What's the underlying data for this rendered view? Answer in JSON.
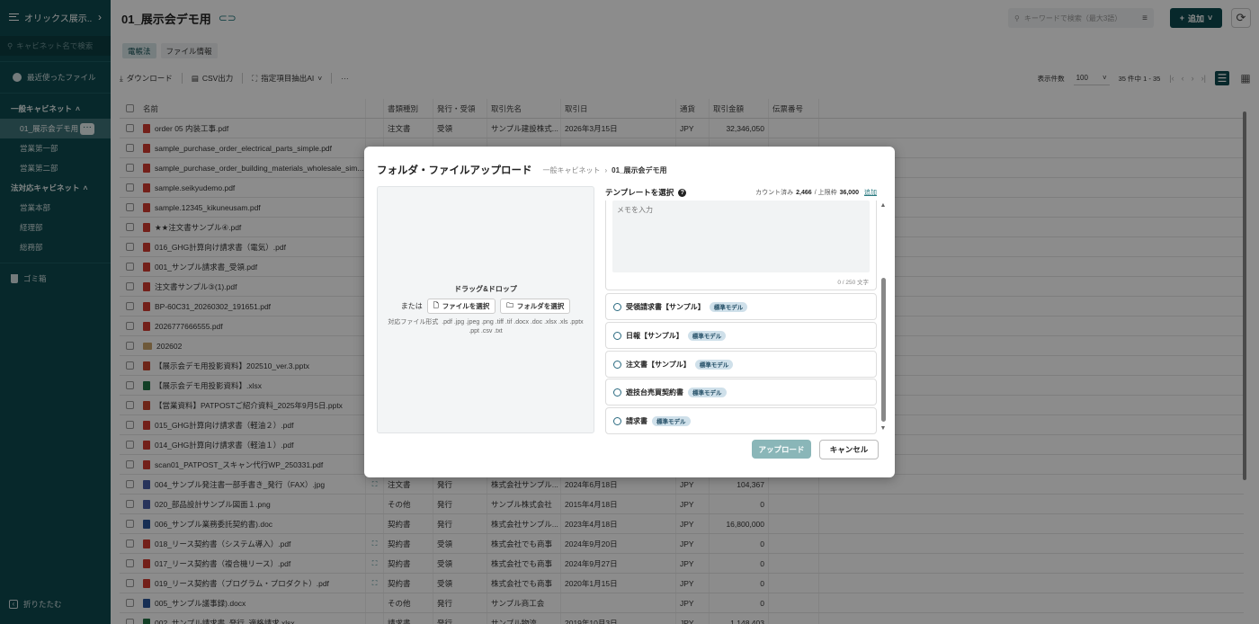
{
  "sidebar": {
    "org_name": "オリックス展示...",
    "search_placeholder": "キャビネット名で検索",
    "recent_label": "最近使ったファイル",
    "groups": [
      {
        "label": "一般キャビネット",
        "items": [
          "01_展示会デモ用",
          "営業第一部",
          "営業第二部"
        ]
      },
      {
        "label": "法対応キャビネット",
        "items": [
          "営業本部",
          "経理部",
          "総務部"
        ]
      }
    ],
    "trash_label": "ゴミ箱",
    "collapse_label": "折りたたむ"
  },
  "header": {
    "title": "01_展示会デモ用",
    "search_placeholder": "キーワードで検索（最大3語）",
    "add_label": "追加"
  },
  "tabs": [
    "電帳法",
    "ファイル情報"
  ],
  "toolbar": {
    "download": "ダウンロード",
    "csv": "CSV出力",
    "ai_extract": "指定項目抽出AI",
    "more": "···",
    "per_page_label": "表示件数",
    "per_page_value": "100",
    "count_text": "35 件中 1 - 35"
  },
  "table": {
    "columns": [
      "名前",
      "書類種別",
      "発行・受領",
      "取引先名",
      "取引日",
      "通貨",
      "取引金額",
      "伝票番号"
    ],
    "rows": [
      {
        "icon": "pdf",
        "name": "order 05 内装工事.pdf",
        "ai": false,
        "type": "注文書",
        "issue": "受領",
        "partner": "サンプル建設株式...",
        "date": "2026年3月15日",
        "cur": "JPY",
        "amount": "32,346,050"
      },
      {
        "icon": "pdf",
        "name": "sample_purchase_order_electrical_parts_simple.pdf",
        "ai": false,
        "type": "",
        "issue": "",
        "partner": "",
        "date": "",
        "cur": "",
        "amount": ""
      },
      {
        "icon": "pdf",
        "name": "sample_purchase_order_building_materials_wholesale_sim...",
        "ai": false,
        "type": "",
        "issue": "",
        "partner": "",
        "date": "",
        "cur": "",
        "amount": ""
      },
      {
        "icon": "pdf",
        "name": "sample.seikyudemo.pdf",
        "ai": false,
        "type": "",
        "issue": "",
        "partner": "",
        "date": "",
        "cur": "",
        "amount": ""
      },
      {
        "icon": "pdf",
        "name": "sample.12345_kikuneusam.pdf",
        "ai": false,
        "type": "",
        "issue": "",
        "partner": "",
        "date": "",
        "cur": "",
        "amount": ""
      },
      {
        "icon": "pdf",
        "name": "★★注文書サンプル④.pdf",
        "ai": true,
        "type": "",
        "issue": "",
        "partner": "",
        "date": "",
        "cur": "",
        "amount": ""
      },
      {
        "icon": "pdf",
        "name": "016_GHG計算向け請求書（電気）.pdf",
        "ai": true,
        "type": "",
        "issue": "",
        "partner": "",
        "date": "",
        "cur": "",
        "amount": ""
      },
      {
        "icon": "pdf",
        "name": "001_サンプル請求書_受領.pdf",
        "ai": true,
        "type": "",
        "issue": "",
        "partner": "",
        "date": "",
        "cur": "",
        "amount": ""
      },
      {
        "icon": "pdf",
        "name": "注文書サンプル③(1).pdf",
        "ai": true,
        "type": "",
        "issue": "",
        "partner": "",
        "date": "",
        "cur": "",
        "amount": ""
      },
      {
        "icon": "pdf",
        "name": "BP-60C31_20260302_191651.pdf",
        "ai": true,
        "type": "",
        "issue": "",
        "partner": "",
        "date": "",
        "cur": "",
        "amount": ""
      },
      {
        "icon": "pdf",
        "name": "2026777666555.pdf",
        "ai": true,
        "type": "",
        "issue": "",
        "partner": "",
        "date": "",
        "cur": "",
        "amount": ""
      },
      {
        "icon": "folder",
        "name": "202602",
        "ai": false,
        "type": "",
        "issue": "",
        "partner": "",
        "date": "",
        "cur": "",
        "amount": ""
      },
      {
        "icon": "pptx",
        "name": "【展示会デモ用投影資料】202510_ver.3.pptx",
        "ai": false,
        "type": "",
        "issue": "",
        "partner": "",
        "date": "",
        "cur": "",
        "amount": ""
      },
      {
        "icon": "xlsx",
        "name": "【展示会デモ用投影資料】.xlsx",
        "ai": false,
        "type": "",
        "issue": "",
        "partner": "",
        "date": "",
        "cur": "",
        "amount": ""
      },
      {
        "icon": "pptx",
        "name": "【営業資料】PATPOSTご紹介資料_2025年9月5日.pptx",
        "ai": false,
        "type": "",
        "issue": "",
        "partner": "",
        "date": "",
        "cur": "",
        "amount": ""
      },
      {
        "icon": "pdf",
        "name": "015_GHG計算向け請求書（軽油２）.pdf",
        "ai": true,
        "type": "",
        "issue": "",
        "partner": "",
        "date": "",
        "cur": "",
        "amount": ""
      },
      {
        "icon": "pdf",
        "name": "014_GHG計算向け請求書（軽油１）.pdf",
        "ai": true,
        "type": "",
        "issue": "",
        "partner": "",
        "date": "",
        "cur": "",
        "amount": ""
      },
      {
        "icon": "pdf",
        "name": "scan01_PATPOST_スキャン代行WP_250331.pdf",
        "ai": true,
        "type": "",
        "issue": "",
        "partner": "",
        "date": "",
        "cur": "",
        "amount": ""
      },
      {
        "icon": "jpg",
        "name": "004_サンプル発注書一部手書き_発行（FAX）.jpg",
        "ai": true,
        "type": "注文書",
        "issue": "発行",
        "partner": "株式会社サンプル...",
        "date": "2024年6月18日",
        "cur": "JPY",
        "amount": "104,367"
      },
      {
        "icon": "jpg",
        "name": "020_部品設計サンプル図面１.png",
        "ai": false,
        "type": "その他",
        "issue": "発行",
        "partner": "サンプル株式会社",
        "date": "2015年4月18日",
        "cur": "JPY",
        "amount": "0"
      },
      {
        "icon": "doc",
        "name": "006_サンプル業務委託契約書).doc",
        "ai": false,
        "type": "契約書",
        "issue": "発行",
        "partner": "株式会社サンプル...",
        "date": "2023年4月18日",
        "cur": "JPY",
        "amount": "16,800,000"
      },
      {
        "icon": "pdf",
        "name": "018_リース契約書（システム導入）.pdf",
        "ai": true,
        "type": "契約書",
        "issue": "受領",
        "partner": "株式会社でも商事",
        "date": "2024年9月20日",
        "cur": "JPY",
        "amount": "0"
      },
      {
        "icon": "pdf",
        "name": "017_リース契約書（複合機リース）.pdf",
        "ai": true,
        "type": "契約書",
        "issue": "受領",
        "partner": "株式会社でも商事",
        "date": "2024年9月27日",
        "cur": "JPY",
        "amount": "0"
      },
      {
        "icon": "pdf",
        "name": "019_リース契約書（プログラム・プロダクト）.pdf",
        "ai": true,
        "type": "契約書",
        "issue": "受領",
        "partner": "株式会社でも商事",
        "date": "2020年1月15日",
        "cur": "JPY",
        "amount": "0"
      },
      {
        "icon": "doc",
        "name": "005_サンプル議事録).docx",
        "ai": false,
        "type": "その他",
        "issue": "発行",
        "partner": "サンプル商工会",
        "date": "",
        "cur": "JPY",
        "amount": "0"
      },
      {
        "icon": "xlsx",
        "name": "002_サンプル請求書_発行_適格請求.xlsx",
        "ai": false,
        "type": "請求書",
        "issue": "発行",
        "partner": "サンプル物流",
        "date": "2019年10月3日",
        "cur": "JPY",
        "amount": "1,148,403"
      }
    ]
  },
  "modal": {
    "title": "フォルダ・ファイルアップロード",
    "breadcrumb_root": "一般キャビネット",
    "breadcrumb_current": "01_展示会デモ用",
    "drop_title": "ドラッグ&ドロップ",
    "or_label": "または",
    "select_file": "ファイルを選択",
    "select_folder": "フォルダを選択",
    "formats_label": "対応ファイル形式",
    "formats": ".pdf .jpg .jpeg .png .tiff .tif .docx .doc .xlsx .xls .pptx .ppt .csv .txt",
    "template_label": "テンプレートを選択",
    "count_label": "カウント済み",
    "count_value": "2,466",
    "limit_label": "/ 上限枠",
    "limit_value": "36,000",
    "add_link": "追加",
    "memo_placeholder": "メモを入力",
    "memo_counter": "0 / 250 文字",
    "templates": [
      {
        "label": "受領請求書【サンプル】",
        "badge": "標準モデル"
      },
      {
        "label": "日報【サンプル】",
        "badge": "標準モデル"
      },
      {
        "label": "注文書【サンプル】",
        "badge": "標準モデル"
      },
      {
        "label": "遊技台売買契約書",
        "badge": "標準モデル"
      },
      {
        "label": "請求書",
        "badge": "標準モデル"
      }
    ],
    "upload_label": "アップロード",
    "cancel_label": "キャンセル"
  }
}
